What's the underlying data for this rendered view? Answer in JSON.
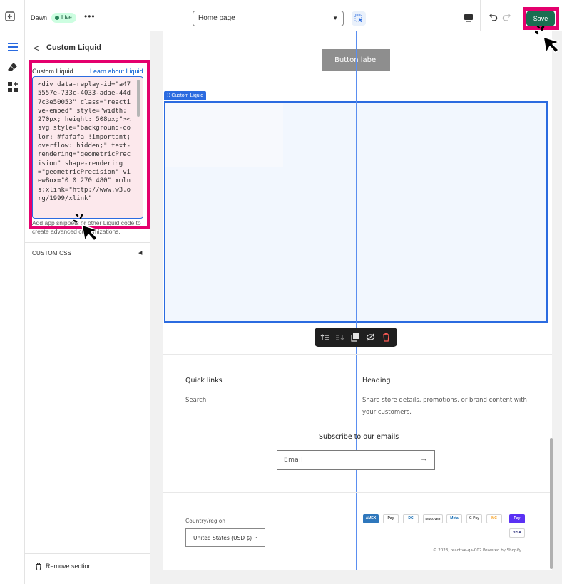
{
  "topbar": {
    "theme_name": "Dawn",
    "live_badge": "Live",
    "more_label": "•••",
    "page_select": "Home page",
    "save_label": "Save"
  },
  "panel": {
    "back_label": "<",
    "title": "Custom Liquid",
    "field_label": "Custom Liquid",
    "learn_link": "Learn about Liquid",
    "code_value": "<div data-replay-id=\"a475557e-733c-4033-adae-44d7c3e50053\" class=\"reactive-embed\" style=\"width: 270px; height: 508px;\"><svg style=\"background-color: #fafafa !important; overflow: hidden;\" text-rendering=\"geometricPrecision\" shape-rendering=\"geometricPrecision\" viewBox=\"0 0 270 480\" xmlns:xlink=\"http://www.w3.org/1999/xlink\"",
    "help_text": "Add app snippets or other Liquid code to create advanced customizations.",
    "custom_css_label": "CUSTOM CSS",
    "remove_section": "Remove section"
  },
  "preview": {
    "button_label": "Button label",
    "custom_liquid_tag": "⁝⁝ Custom Liquid",
    "quick_links": "Quick links",
    "search_link": "Search",
    "heading": "Heading",
    "heading_text": "Share store details, promotions, or brand content with your customers.",
    "subscribe": "Subscribe to our emails",
    "email_placeholder": "Email",
    "country_label": "Country/region",
    "country_value": "United States (USD $)",
    "payment_icons": [
      "AMEX",
      "Pay",
      "DC",
      "DISCOVER",
      "Meta",
      "G Pay",
      "MC",
      "Pay",
      "VISA"
    ],
    "copyright": "© 2023, reactive-qa-002 Powered by Shopify"
  },
  "colors": {
    "save_green": "#1a6e51",
    "highlight_pink": "#e4006d",
    "selection_blue": "#2b6be0"
  }
}
